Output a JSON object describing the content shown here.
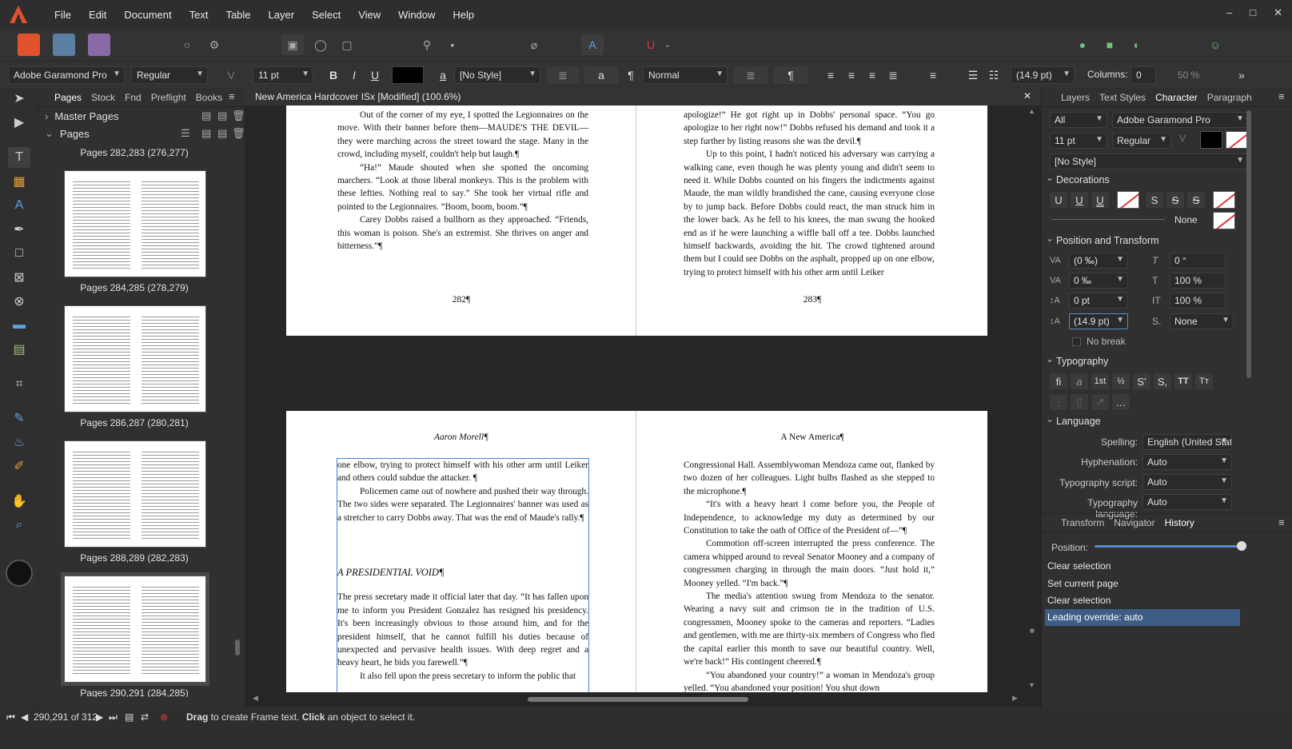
{
  "menu": [
    "File",
    "Edit",
    "Document",
    "Text",
    "Table",
    "Layer",
    "Select",
    "View",
    "Window",
    "Help"
  ],
  "window_controls": {
    "minimize": "–",
    "maximize": "□",
    "close": "✕"
  },
  "context_bar": {
    "font_family": "Adobe Garamond Pro",
    "font_style": "Regular",
    "font_size": "11 pt",
    "bold": "B",
    "italic": "I",
    "underline": "U",
    "char_style": "[No Style]",
    "para_style": "Normal",
    "leading": "(14.9 pt)",
    "columns_label": "Columns:",
    "columns_value": "0",
    "zoom": "50 %"
  },
  "pages_panel": {
    "tabs": [
      "Pages",
      "Stock",
      "Fnd",
      "Preflight",
      "Books"
    ],
    "master_pages": "Master Pages",
    "pages": "Pages",
    "top_label": "Pages 282,283 (276,277)",
    "thumbs": [
      {
        "label": "Pages 284,285 (278,279)"
      },
      {
        "label": "Pages 286,287 (280,281)"
      },
      {
        "label": "Pages 288,289 (282,283)"
      },
      {
        "label": "Pages 290,291 (284,285)"
      }
    ]
  },
  "document": {
    "tab_title": "New America Hardcover ISx [Modified] (100.6%)",
    "spread1": {
      "left_paras": [
        "Out of the corner of my eye, I spotted the Legionnaires on the move. With their banner before them—MAUDE'S THE DEVIL—they were marching across the street toward the stage. Many in the crowd, including myself, couldn't help but laugh.¶",
        "“Ha!” Maude shouted when she spotted the oncoming marchers. “Look at those liberal monkeys. This is the problem with these lefties. Nothing real to say.” She took her virtual rifle and pointed to the Legionnaires. “Boom, boom, boom.”¶",
        "Carey Dobbs raised a bullhorn as they approached. “Friends, this woman is poison. She's an extremist. She thrives on anger and bitterness.”¶"
      ],
      "left_folio": "282¶",
      "right_para_first": "apologize!” He got right up in Dobbs' personal space. “You go apologize to her right now!” Dobbs refused his demand and took it a step further by listing reasons she was the devil.¶",
      "right_para_second": "Up to this point, I hadn't noticed his adversary was carrying a walking cane, even though he was plenty young and didn't seem to need it. While Dobbs counted on his fingers the indictments against Maude, the man wildly brandished the cane, causing everyone close by to jump back. Before Dobbs could react, the man struck him in the lower back. As he fell to his knees, the man swung the hooked end as if he were launching a wiffle ball off a tee. Dobbs launched himself backwards, avoiding the hit. The crowd tightened around them but I could see Dobbs on the asphalt, propped up on one elbow, trying to protect himself with his other arm until Leiker",
      "right_folio": "283¶"
    },
    "spread2": {
      "left_header": "Aaron Morell¶",
      "right_header": "A New America¶",
      "left_para1": "one elbow, trying to protect himself with his other arm until Leiker and others could subdue the attacker. ¶",
      "left_para2": "Policemen came out of nowhere and pushed their way through. The two sides were separated. The Legionnaires' banner was used as a stretcher to carry Dobbs away. That was the end of Maude's rally.¶",
      "left_heading": "A PRESIDENTIAL VOID¶",
      "left_para3": "The press secretary made it official later that day. “It has fallen upon me to inform you President Gonzalez has resigned his presidency. It's been increasingly obvious to those around him, and for the president himself, that he cannot fulfill his duties because of unexpected and pervasive health issues. With deep regret and a heavy heart, he bids you farewell.”¶",
      "left_para4": "It also fell upon the press secretary to inform the public that",
      "right_paras": [
        "Congressional Hall. Assemblywoman Mendoza came out, flanked by two dozen of her colleagues. Light bulbs flashed as she stepped to the microphone.¶",
        "“It's with a heavy heart I come before you, the People of Independence, to acknowledge my duty as determined by our Constitution to take the oath of Office of the President of—”¶",
        "Commotion off-screen interrupted the press conference. The camera whipped around to reveal Senator Mooney and a company of congressmen charging in through the main doors. “Just hold it,” Mooney yelled. “I'm back.”¶",
        "The media's attention swung from Mendoza to the senator. Wearing a navy suit and crimson tie in the tradition of U.S. congressmen, Mooney spoke to the cameras and reporters. “Ladies and gentlemen, with me are thirty-six members of Congress who fled the capital earlier this month to save our beautiful country. Well, we're back!” His contingent cheered.¶",
        "“You abandoned your country!” a woman in Mendoza's group yelled. “You abandoned your position! You shut down"
      ]
    }
  },
  "right_panel": {
    "tabs": [
      "Layers",
      "Text Styles",
      "Character",
      "Paragraph"
    ],
    "filter": "All",
    "font_family": "Adobe Garamond Pro",
    "font_size": "11 pt",
    "font_style": "Regular",
    "char_style": "[No Style]",
    "decorations": "Decorations",
    "deco_none": "None",
    "position_transform": "Position and Transform",
    "tracking": "(0 ‰)",
    "kerning": "0 ‰",
    "baseline": "0 pt",
    "leading": "(14.9 pt)",
    "shear": "0 °",
    "scale_h": "100 %",
    "scale_v": "100 %",
    "script": "None",
    "no_break": "No break",
    "typography": "Typography",
    "language": "Language",
    "spelling_label": "Spelling:",
    "spelling": "English (United State",
    "hyphenation_label": "Hyphenation:",
    "hyphenation": "Auto",
    "typo_script_label": "Typography script:",
    "typo_script": "Auto",
    "typo_lang_label": "Typography language:",
    "typo_lang": "Auto",
    "bottom_tabs": [
      "Transform",
      "Navigator",
      "History"
    ],
    "position_label": "Position:",
    "history": [
      "Clear selection",
      "Set current page",
      "Clear selection",
      "Leading override: auto"
    ]
  },
  "status": {
    "page_info": "290,291 of 312",
    "hint_drag": "Drag",
    "hint_mid": " to create Frame text. ",
    "hint_click": "Click",
    "hint_end": " an object to select it."
  },
  "colors": {
    "accent": "#3d5d85",
    "selection_frame": "#4a7fd4",
    "brand": "#e0512c"
  }
}
